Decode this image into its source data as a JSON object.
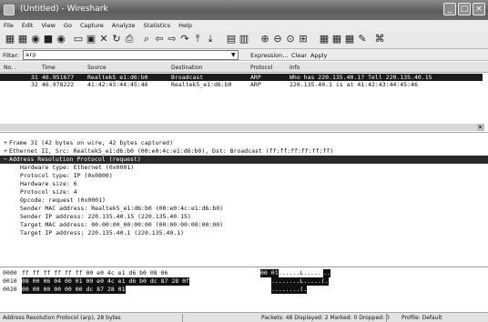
{
  "window": {
    "title": "(Untitled) - Wireshark",
    "controls": [
      "_",
      "□",
      "×"
    ]
  },
  "menu": [
    "File",
    "Edit",
    "View",
    "Go",
    "Capture",
    "Analyze",
    "Statistics",
    "Help"
  ],
  "toolbar_icons": [
    "interfaces-icon",
    "options-icon",
    "start-capture-icon",
    "stop-capture-icon",
    "restart-capture-icon",
    "open-icon",
    "save-icon",
    "close-file-icon",
    "reload-icon",
    "print-icon",
    "find-icon",
    "back-icon",
    "forward-icon",
    "goto-icon",
    "top-icon",
    "bottom-icon",
    "colorize-icon",
    "autoscroll-icon",
    "zoom-in-icon",
    "zoom-out-icon",
    "normal-size-icon",
    "resize-columns-icon",
    "capture-filters-icon",
    "display-filters-icon",
    "coloring-rules-icon",
    "preferences-icon",
    "help-icon"
  ],
  "filter": {
    "label": "Filter:",
    "value": "arp",
    "buttons": [
      "Expression...",
      "Clear",
      "Apply"
    ]
  },
  "packet_list": {
    "columns": [
      "No. .",
      "Time",
      "Source",
      "Destination",
      "Protocol",
      "Info"
    ],
    "rows": [
      {
        "no": "31",
        "time": "46.951677",
        "source": "Realtek5_e1:d6:b0",
        "destination": "Broadcast",
        "protocol": "ARP",
        "info": "Who has 220.135.40.1?  Tell 220.135.40.15",
        "selected": true
      },
      {
        "no": "32",
        "time": "46.978222",
        "source": "41:42:43:44:45:46",
        "destination": "Realtek5_e1:d6:b0",
        "protocol": "ARP",
        "info": "220.135.40.1 is at 41:42:43:44:45:46",
        "selected": false
      }
    ]
  },
  "details": [
    {
      "level": 0,
      "expander": "+",
      "text": "Frame 31 (42 bytes on wire, 42 bytes captured)",
      "selected": false
    },
    {
      "level": 0,
      "expander": "+",
      "text": "Ethernet II, Src: Realtek5_e1:d6:b0 (00:e0:4c:e1:d6:b0), Dst: Broadcast (ff:ff:ff:ff:ff:ff)",
      "selected": false
    },
    {
      "level": 0,
      "expander": "−",
      "text": "Address Resolution Protocol (request)",
      "selected": true
    },
    {
      "level": 1,
      "expander": "",
      "text": "Hardware type: Ethernet (0x0001)",
      "selected": false
    },
    {
      "level": 1,
      "expander": "",
      "text": "Protocol type: IP (0x0800)",
      "selected": false
    },
    {
      "level": 1,
      "expander": "",
      "text": "Hardware size: 6",
      "selected": false
    },
    {
      "level": 1,
      "expander": "",
      "text": "Protocol size: 4",
      "selected": false
    },
    {
      "level": 1,
      "expander": "",
      "text": "Opcode: request (0x0001)",
      "selected": false
    },
    {
      "level": 1,
      "expander": "",
      "text": "Sender MAC address: Realtek5_e1:d6:b0 (00:e0:4c:e1:d6:b0)",
      "selected": false
    },
    {
      "level": 1,
      "expander": "",
      "text": "Sender IP address: 220.135.40.15 (220.135.40.15)",
      "selected": false
    },
    {
      "level": 1,
      "expander": "",
      "text": "Target MAC address: 00:00:00_00:00:00 (00:00:00:00:00:00)",
      "selected": false
    },
    {
      "level": 1,
      "expander": "",
      "text": "Target IP address: 220.135.40.1 (220.135.40.1)",
      "selected": false
    }
  ],
  "bytes": [
    {
      "offset": "0000",
      "hex_plain": "ff ff ff ff ff ff 00 e0  4c e1 d6 b0 08 06",
      "hex_hl": "00 01",
      "ascii_plain": "........L.....",
      "ascii_hl": ".."
    },
    {
      "offset": "0010",
      "hex_plain": "",
      "hex_hl": "08 00 06 04 00 01 00 e0  4c e1 d6 b0 dc 87 28 0f",
      "ascii_plain": "",
      "ascii_hl": "........L.....(."
    },
    {
      "offset": "0020",
      "hex_plain": "",
      "hex_hl": "00 00 00 00 00 00 dc 87  28 01",
      "ascii_plain": "",
      "ascii_hl": "........(."
    }
  ],
  "status": {
    "left": "Address Resolution Protocol (arp), 28 bytes",
    "middle": "Packets: 48 Displayed: 2 Marked: 0 Dropped: 0",
    "right": "Profile: Default"
  }
}
